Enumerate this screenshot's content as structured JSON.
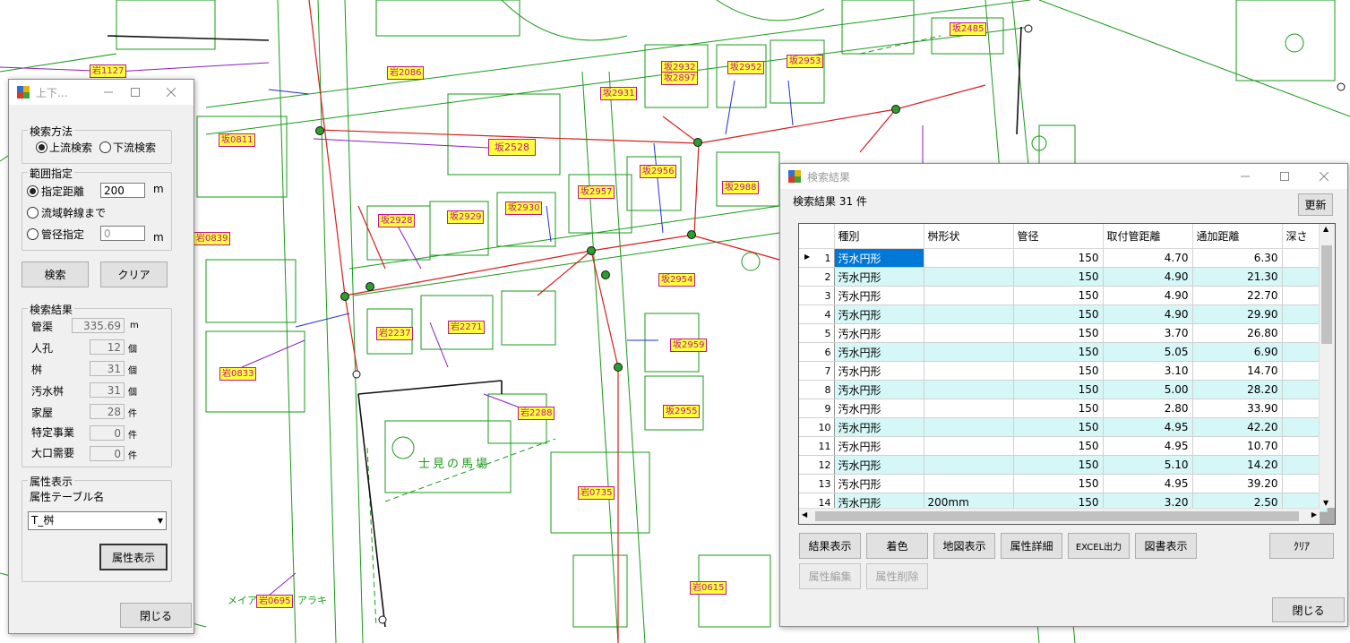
{
  "map": {
    "labels": [
      "岩1127",
      "岩2086",
      "坂0811",
      "坂2528",
      "坂2931",
      "坂2932",
      "坂2897",
      "坂2952",
      "坂2953",
      "坂2956",
      "坂2957",
      "坂2988",
      "坂2928",
      "坂2929",
      "坂2930",
      "坂2954",
      "岩0839",
      "岩2237",
      "岩2271",
      "坂2959",
      "岩0833",
      "坂2955",
      "岩2288",
      "岩0735",
      "岩0695",
      "岩0615",
      "坂2485"
    ],
    "texts": [
      "士見の馬場",
      "メイア",
      "アラキ"
    ]
  },
  "left_dialog": {
    "title": "上下...",
    "search_method": {
      "label": "検索方法",
      "upstream": "上流検索",
      "downstream": "下流検索",
      "selected": "上流検索"
    },
    "range": {
      "label": "範囲指定",
      "distance_label": "指定距離",
      "distance_value": "200",
      "distance_unit": "m",
      "trunk_label": "流域幹線まで",
      "diameter_label": "管径指定",
      "diameter_value": "0",
      "diameter_unit": "m"
    },
    "search_button": "検索",
    "clear_button": "クリア",
    "results": {
      "label": "検索結果",
      "pipe_label": "管渠",
      "pipe_value": "335.69",
      "pipe_unit": "m",
      "manhole_label": "人孔",
      "manhole_value": "12",
      "manhole_unit": "個",
      "masu_label": "桝",
      "masu_value": "31",
      "masu_unit": "個",
      "sewage_masu_label": "汚水桝",
      "sewage_masu_value": "31",
      "sewage_masu_unit": "個",
      "house_label": "家屋",
      "house_value": "28",
      "house_unit": "件",
      "specified_label": "特定事業",
      "specified_value": "0",
      "specified_unit": "件",
      "large_label": "大口需要",
      "large_value": "0",
      "large_unit": "件"
    },
    "attr": {
      "label": "属性表示",
      "table_name_label": "属性テーブル名",
      "table_value": "T_桝",
      "show_button": "属性表示"
    },
    "close_button": "閉じる"
  },
  "right_dialog": {
    "title": "検索結果",
    "count_text": "検索結果 31 件",
    "refresh_button": "更新",
    "columns": [
      "種別",
      "桝形状",
      "管径",
      "取付管距離",
      "通加距離",
      "深さ"
    ],
    "rows": [
      {
        "no": "1",
        "type": "汚水円形",
        "shape": "",
        "diameter": "150",
        "attach": "4.70",
        "dist": "6.30"
      },
      {
        "no": "2",
        "type": "汚水円形",
        "shape": "",
        "diameter": "150",
        "attach": "4.90",
        "dist": "21.30"
      },
      {
        "no": "3",
        "type": "汚水円形",
        "shape": "",
        "diameter": "150",
        "attach": "4.90",
        "dist": "22.70"
      },
      {
        "no": "4",
        "type": "汚水円形",
        "shape": "",
        "diameter": "150",
        "attach": "4.90",
        "dist": "29.90"
      },
      {
        "no": "5",
        "type": "汚水円形",
        "shape": "",
        "diameter": "150",
        "attach": "3.70",
        "dist": "26.80"
      },
      {
        "no": "6",
        "type": "汚水円形",
        "shape": "",
        "diameter": "150",
        "attach": "5.05",
        "dist": "6.90"
      },
      {
        "no": "7",
        "type": "汚水円形",
        "shape": "",
        "diameter": "150",
        "attach": "3.10",
        "dist": "14.70"
      },
      {
        "no": "8",
        "type": "汚水円形",
        "shape": "",
        "diameter": "150",
        "attach": "5.00",
        "dist": "28.20"
      },
      {
        "no": "9",
        "type": "汚水円形",
        "shape": "",
        "diameter": "150",
        "attach": "2.80",
        "dist": "33.90"
      },
      {
        "no": "10",
        "type": "汚水円形",
        "shape": "",
        "diameter": "150",
        "attach": "4.95",
        "dist": "42.20"
      },
      {
        "no": "11",
        "type": "汚水円形",
        "shape": "",
        "diameter": "150",
        "attach": "4.95",
        "dist": "10.70"
      },
      {
        "no": "12",
        "type": "汚水円形",
        "shape": "",
        "diameter": "150",
        "attach": "5.10",
        "dist": "14.20"
      },
      {
        "no": "13",
        "type": "汚水円形",
        "shape": "",
        "diameter": "150",
        "attach": "4.95",
        "dist": "39.20"
      },
      {
        "no": "14",
        "type": "汚水円形",
        "shape": "200mm",
        "diameter": "150",
        "attach": "3.20",
        "dist": "2.50"
      }
    ],
    "buttons": {
      "show_results": "結果表示",
      "color": "着色",
      "map_display": "地図表示",
      "attr_detail": "属性詳細",
      "excel": "EXCEL出力",
      "drawing": "図書表示",
      "clear": "ｸﾘｱ",
      "attr_edit": "属性編集",
      "attr_delete": "属性削除",
      "close": "閉じる"
    }
  },
  "colors": {
    "map_green": "#1a9a1a",
    "map_red": "#d81e1e",
    "map_blue": "#1c2fd6",
    "map_purple": "#8a1cc4",
    "label_yellow": "#ffff3a",
    "selection": "#0078d7",
    "row_alt": "#d6f7f7"
  }
}
